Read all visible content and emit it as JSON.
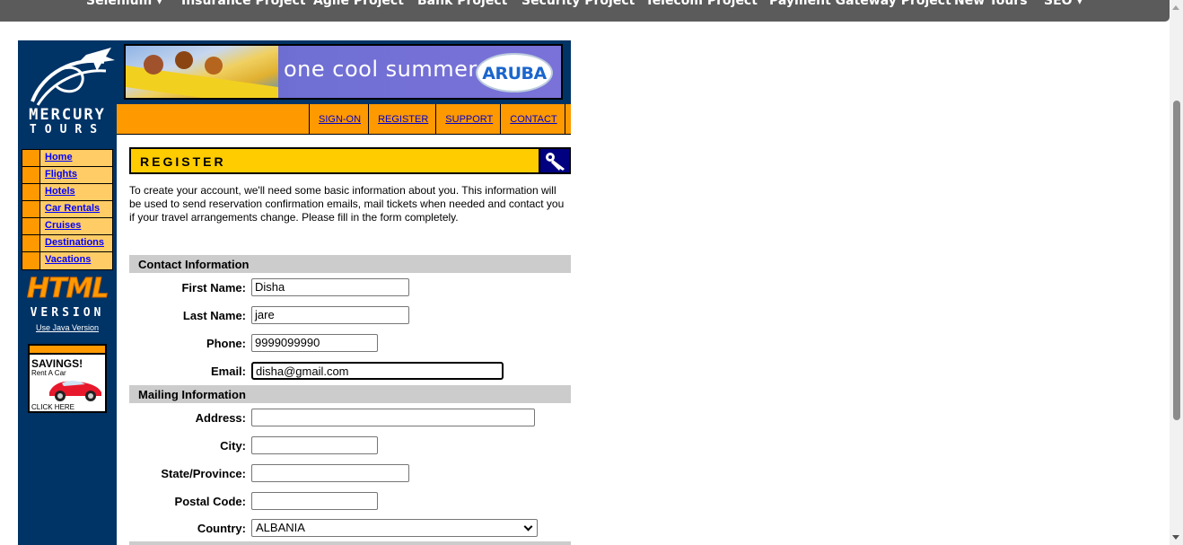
{
  "topnav": {
    "items": [
      "Selenium ▾",
      "Insurance Project",
      "Agile Project",
      "Bank Project",
      "Security Project",
      "Telecom Project",
      "Payment Gateway Project",
      "New Tours",
      "SEO ▾"
    ]
  },
  "sidebar": {
    "logo_top": "MERCURY",
    "logo_bottom": "TOURS",
    "menu": [
      "Home",
      "Flights",
      "Hotels",
      "Car Rentals",
      "Cruises",
      "Destinations",
      "Vacations"
    ],
    "html_badge": "HTML",
    "version_label": "VERSION",
    "java_link": "Use Java Version",
    "ad": {
      "headline": "SAVINGS!",
      "subline": "Rent A Car",
      "cta": "CLICK HERE"
    }
  },
  "banner": {
    "slogan": "one cool summer",
    "brand": "ARUBA"
  },
  "nav": {
    "links": [
      "SIGN-ON",
      "REGISTER",
      "SUPPORT",
      "CONTACT"
    ]
  },
  "register": {
    "title": "REGISTER",
    "intro": "To create your account, we'll need some basic information about you. This information will be used to send reservation confirmation emails, mail tickets when needed and contact you if your travel arrangements change. Please fill in the form completely."
  },
  "form": {
    "contact_section": "Contact Information",
    "mailing_section": "Mailing Information",
    "first_name": {
      "label": "First Name:",
      "value": "Disha"
    },
    "last_name": {
      "label": "Last Name:",
      "value": "jare"
    },
    "phone": {
      "label": "Phone:",
      "value": "9999099990"
    },
    "email": {
      "label": "Email:",
      "value": "disha@gmail.com"
    },
    "address": {
      "label": "Address:",
      "value": ""
    },
    "city": {
      "label": "City:",
      "value": ""
    },
    "state": {
      "label": "State/Province:",
      "value": ""
    },
    "postal": {
      "label": "Postal Code:",
      "value": ""
    },
    "country": {
      "label": "Country:",
      "value": "ALBANIA"
    }
  },
  "colors": {
    "sidebar_bg": "#003366",
    "nav_orange": "#ff9900",
    "header_yellow": "#ffcc00",
    "menu_cell": "#ffcc66",
    "link_blue": "#0000ff"
  }
}
